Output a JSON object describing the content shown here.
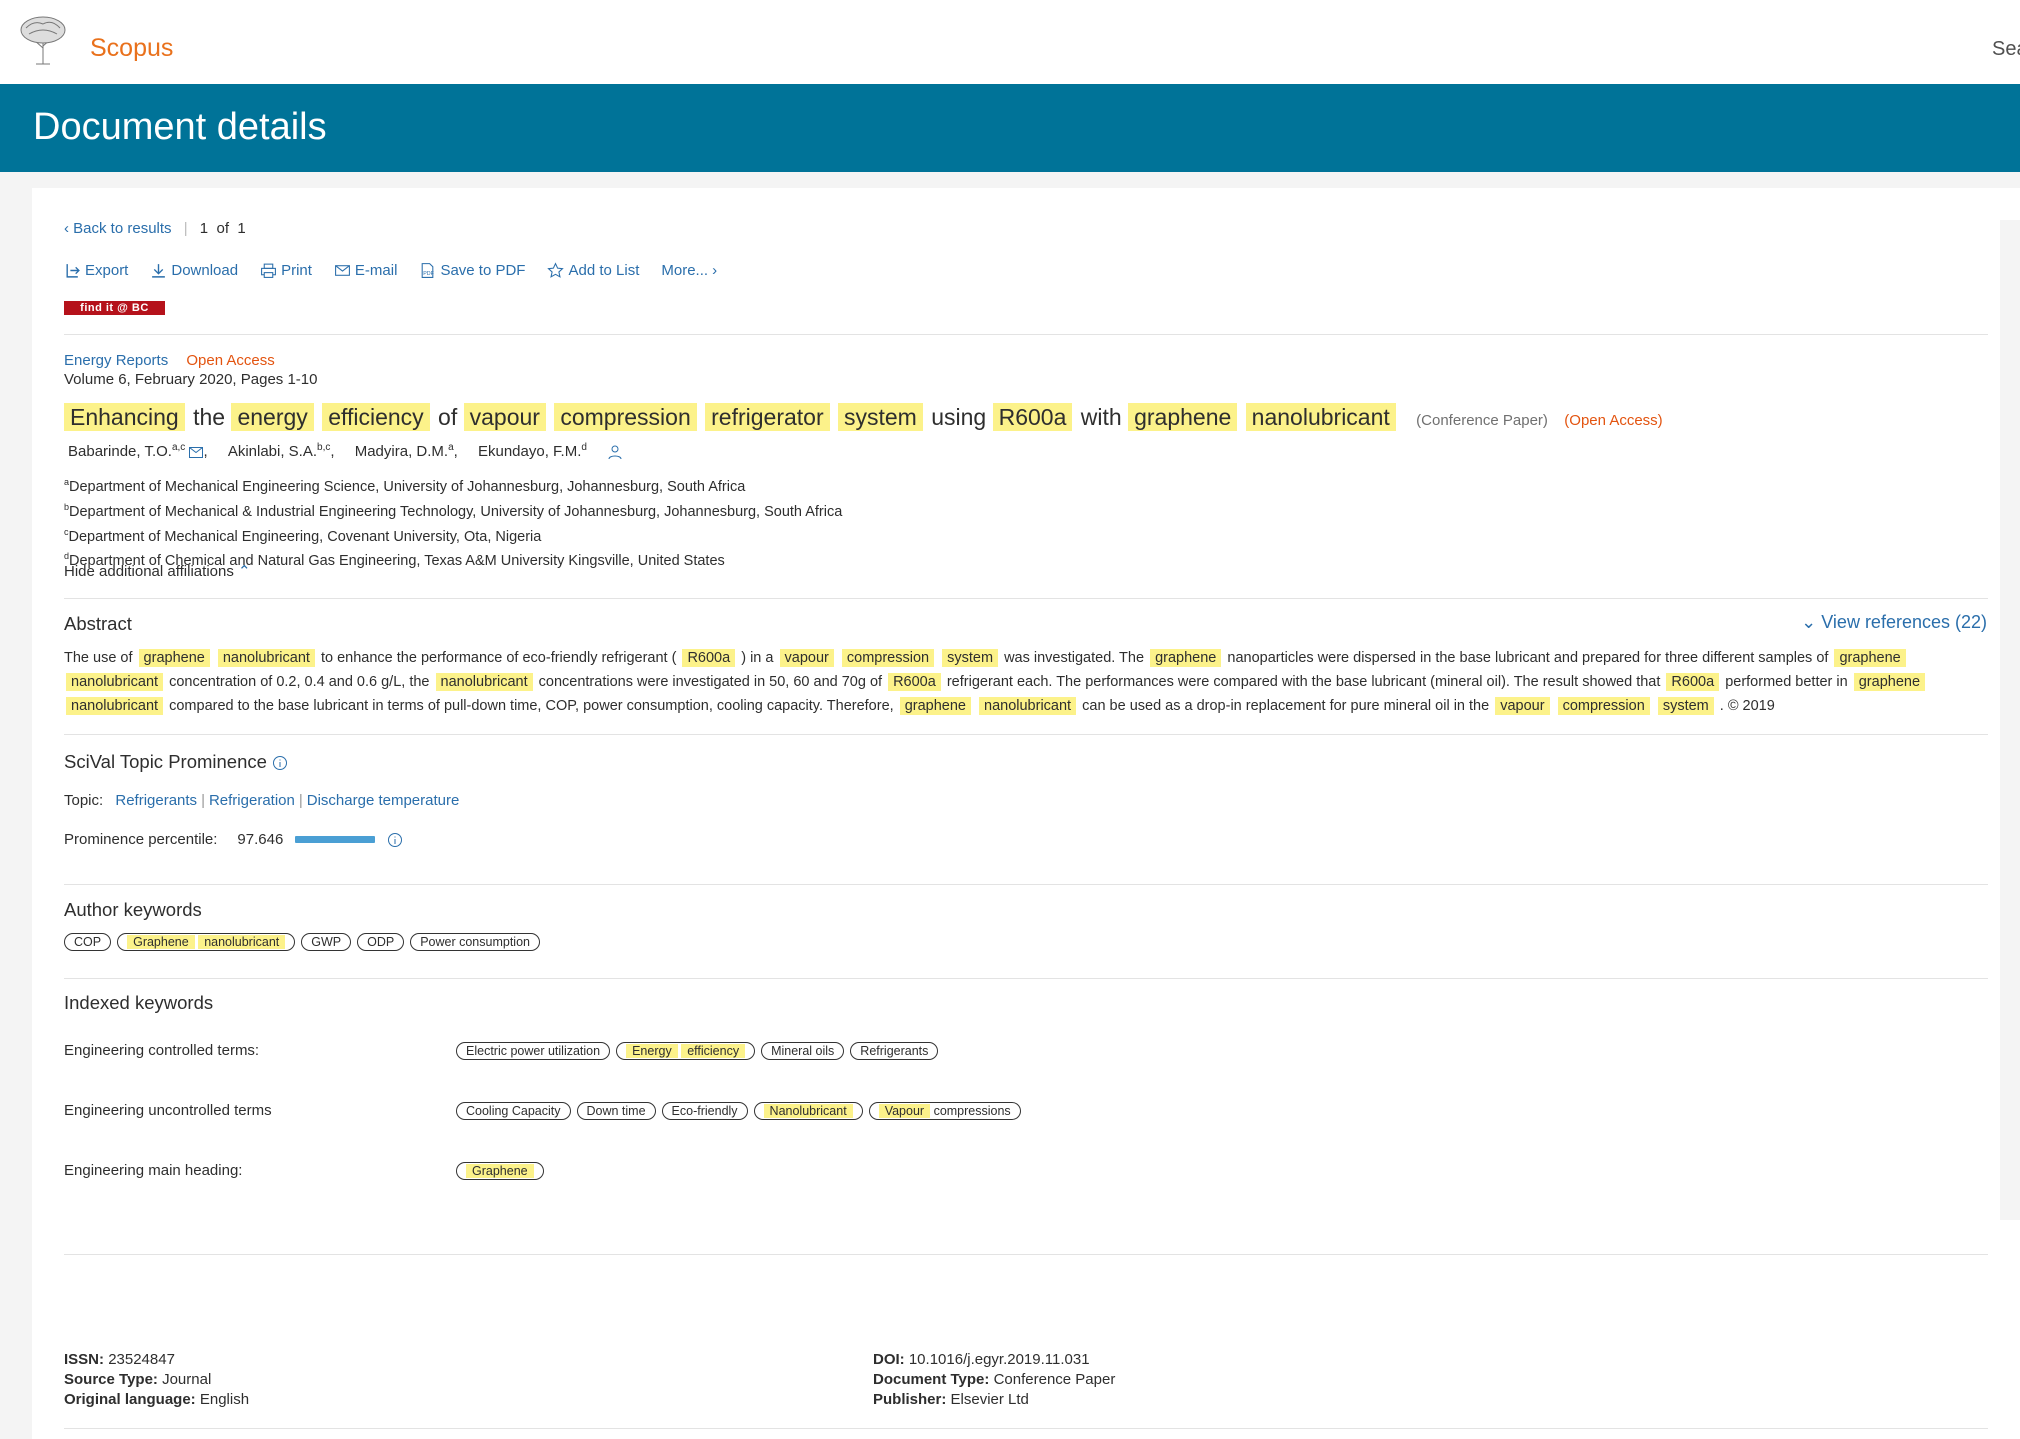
{
  "header": {
    "brand": "Scopus",
    "search_label": "Search"
  },
  "banner": {
    "title": "Document details"
  },
  "nav": {
    "back_label": "Back to results",
    "page_of": "1  of  1"
  },
  "actions": [
    {
      "label": "Export",
      "icon": "export-icon"
    },
    {
      "label": "Download",
      "icon": "download-icon"
    },
    {
      "label": "Print",
      "icon": "print-icon"
    },
    {
      "label": "E-mail",
      "icon": "email-icon"
    },
    {
      "label": "Save to PDF",
      "icon": "pdf-icon"
    },
    {
      "label": "Add to List",
      "icon": "star-icon"
    },
    {
      "label": "More...",
      "icon": "chevron-right-icon"
    }
  ],
  "findit_label": "find it @ BC",
  "document": {
    "source": "Energy Reports",
    "open_access": "Open Access",
    "volume_line": "Volume 6, February 2020, Pages 1-10",
    "title_words": [
      {
        "t": "Enhancing",
        "hl": true
      },
      {
        "t": "the",
        "hl": false
      },
      {
        "t": "energy",
        "hl": true
      },
      {
        "t": "efficiency",
        "hl": true
      },
      {
        "t": "of",
        "hl": false
      },
      {
        "t": "vapour",
        "hl": true
      },
      {
        "t": "compression",
        "hl": true
      },
      {
        "t": "refrigerator",
        "hl": true
      },
      {
        "t": "system",
        "hl": true
      },
      {
        "t": "using",
        "hl": false
      },
      {
        "t": "R600a",
        "hl": true
      },
      {
        "t": "with",
        "hl": false
      },
      {
        "t": "graphene",
        "hl": true
      },
      {
        "t": "nanolubricant",
        "hl": true
      }
    ],
    "doc_type_tag": "(Conference Paper)",
    "oa_tag": "(Open Access)",
    "authors": [
      {
        "name": "Babarinde, T.O.",
        "sup": "a,c"
      },
      {
        "name": "Akinlabi, S.A.",
        "sup": "b,c"
      },
      {
        "name": "Madyira, D.M.",
        "sup": "a"
      },
      {
        "name": "Ekundayo, F.M.",
        "sup": "d"
      }
    ],
    "affiliations": [
      {
        "sup": "a",
        "text": "Department of Mechanical Engineering Science, University of Johannesburg, Johannesburg, South Africa"
      },
      {
        "sup": "b",
        "text": "Department of Mechanical & Industrial Engineering Technology, University of Johannesburg, Johannesburg, South Africa"
      },
      {
        "sup": "c",
        "text": "Department of Mechanical Engineering, Covenant University, Ota, Nigeria"
      },
      {
        "sup": "d",
        "text": "Department of Chemical and Natural Gas Engineering, Texas A&M University Kingsville, United States"
      }
    ],
    "hide_affiliations": "Hide additional affiliations"
  },
  "abstract": {
    "heading": "Abstract",
    "view_refs": "View references (22)",
    "segments": [
      {
        "t": "The use of",
        "hl": false
      },
      {
        "t": "graphene",
        "hl": true
      },
      {
        "t": "nanolubricant",
        "hl": true
      },
      {
        "t": "to enhance the performance of eco-friendly refrigerant (",
        "hl": false
      },
      {
        "t": "R600a",
        "hl": true
      },
      {
        "t": ") in a",
        "hl": false
      },
      {
        "t": "vapour",
        "hl": true
      },
      {
        "t": "compression",
        "hl": true
      },
      {
        "t": "system",
        "hl": true
      },
      {
        "t": "was investigated. The",
        "hl": false
      },
      {
        "t": "graphene",
        "hl": true
      },
      {
        "t": "nanoparticles were dispersed in the base lubricant and prepared for three different samples of",
        "hl": false
      },
      {
        "t": "graphene",
        "hl": true
      },
      {
        "t": "nanolubricant",
        "hl": true
      },
      {
        "t": "concentration of 0.2, 0.4 and 0.6 g/L, the",
        "hl": false
      },
      {
        "t": "nanolubricant",
        "hl": true
      },
      {
        "t": "concentrations were investigated in 50, 60 and 70g of",
        "hl": false
      },
      {
        "t": "R600a",
        "hl": true
      },
      {
        "t": "refrigerant each. The performances were compared with the base lubricant (mineral oil). The result showed that",
        "hl": false
      },
      {
        "t": "R600a",
        "hl": true
      },
      {
        "t": "performed better in",
        "hl": false
      },
      {
        "t": "graphene",
        "hl": true
      },
      {
        "t": "nanolubricant",
        "hl": true
      },
      {
        "t": "compared to the base lubricant in terms of pull-down time, COP, power consumption, cooling capacity. Therefore,",
        "hl": false
      },
      {
        "t": "graphene",
        "hl": true
      },
      {
        "t": "nanolubricant",
        "hl": true
      },
      {
        "t": "can be used as a drop-in replacement for pure mineral oil in the",
        "hl": false
      },
      {
        "t": "vapour",
        "hl": true
      },
      {
        "t": "compression",
        "hl": true
      },
      {
        "t": "system",
        "hl": true
      },
      {
        "t": ". © 2019",
        "hl": false
      }
    ]
  },
  "scival": {
    "heading": "SciVal Topic Prominence",
    "topic_label": "Topic:",
    "topics": [
      "Refrigerants",
      "Refrigeration",
      "Discharge temperature"
    ],
    "prominence_label": "Prominence percentile:",
    "prominence_value": "97.646",
    "prominence_fraction": 0.97646
  },
  "author_keywords": {
    "heading": "Author keywords",
    "items": [
      {
        "parts": [
          {
            "t": "COP",
            "hl": false
          }
        ]
      },
      {
        "parts": [
          {
            "t": "Graphene",
            "hl": true
          },
          {
            "t": "nanolubricant",
            "hl": true
          }
        ]
      },
      {
        "parts": [
          {
            "t": "GWP",
            "hl": false
          }
        ]
      },
      {
        "parts": [
          {
            "t": "ODP",
            "hl": false
          }
        ]
      },
      {
        "parts": [
          {
            "t": "Power consumption",
            "hl": false
          }
        ]
      }
    ]
  },
  "indexed_keywords": {
    "heading": "Indexed keywords",
    "groups": [
      {
        "label": "Engineering controlled terms:",
        "items": [
          {
            "parts": [
              {
                "t": "Electric power utilization",
                "hl": false
              }
            ]
          },
          {
            "parts": [
              {
                "t": "Energy",
                "hl": true
              },
              {
                "t": "efficiency",
                "hl": true
              }
            ]
          },
          {
            "parts": [
              {
                "t": "Mineral oils",
                "hl": false
              }
            ]
          },
          {
            "parts": [
              {
                "t": "Refrigerants",
                "hl": false
              }
            ]
          }
        ]
      },
      {
        "label": "Engineering uncontrolled terms",
        "items": [
          {
            "parts": [
              {
                "t": "Cooling Capacity",
                "hl": false
              }
            ]
          },
          {
            "parts": [
              {
                "t": "Down time",
                "hl": false
              }
            ]
          },
          {
            "parts": [
              {
                "t": "Eco-friendly",
                "hl": false
              }
            ]
          },
          {
            "parts": [
              {
                "t": "Nanolubricant",
                "hl": true
              }
            ]
          },
          {
            "parts": [
              {
                "t": "Vapour",
                "hl": true
              },
              {
                "t": "compressions",
                "hl": false
              }
            ]
          }
        ]
      },
      {
        "label": "Engineering main heading:",
        "items": [
          {
            "parts": [
              {
                "t": "Graphene",
                "hl": true
              }
            ]
          }
        ]
      }
    ]
  },
  "info": {
    "issn_label": "ISSN:",
    "issn": "23524847",
    "source_type_label": "Source Type:",
    "source_type": "Journal",
    "language_label": "Original language:",
    "language": "English",
    "doi_label": "DOI:",
    "doi": "10.1016/j.egyr.2019.11.031",
    "doc_type_label": "Document Type:",
    "doc_type": "Conference Paper",
    "publisher_label": "Publisher:",
    "publisher": "Elsevier Ltd"
  },
  "colors": {
    "accent_bar": "#007398",
    "brand": "#e9711c",
    "link": "#2a6eab",
    "highlight": "#fcf28a",
    "open_access": "#e35410"
  }
}
